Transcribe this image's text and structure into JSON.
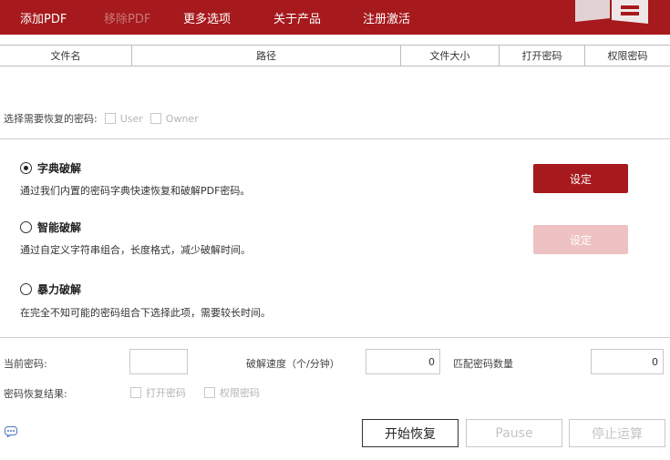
{
  "menu": {
    "add_pdf": "添加PDF",
    "remove_pdf": "移除PDF",
    "more_options": "更多选项",
    "about": "关于产品",
    "register": "注册激活"
  },
  "colors": {
    "brand_red": "#a6191c",
    "disabled_red": "#eec2c3"
  },
  "file_table": {
    "columns": [
      "文件名",
      "路径",
      "文件大小",
      "打开密码",
      "权限密码"
    ]
  },
  "recover": {
    "label": "选择需要恢复的密码:",
    "user": "User",
    "owner": "Owner"
  },
  "modes": [
    {
      "title": "字典破解",
      "desc": "通过我们内置的密码字典快速恢复和破解PDF密码。",
      "checked": true,
      "button": "设定"
    },
    {
      "title": "智能破解",
      "desc": "通过自定义字符串组合，长度格式，减少破解时间。",
      "checked": false,
      "button": "设定"
    },
    {
      "title": "暴力破解",
      "desc": "在完全不知可能的密码组合下选择此项，需要较长时间。",
      "checked": false
    }
  ],
  "status": {
    "current_password_label": "当前密码:",
    "current_password_value": "",
    "speed_label": "破解速度（个/分钟）",
    "speed_value": "0",
    "match_label": "匹配密码数量",
    "match_value": "0",
    "result_label": "密码恢复结果:",
    "open_password": "打开密码",
    "permission_password": "权限密码"
  },
  "actions": {
    "start": "开始恢复",
    "pause": "Pause",
    "stop": "停止运算"
  },
  "icons": {
    "chat": "chat-bubble-icon",
    "logo": "pdf-logo-icon"
  }
}
